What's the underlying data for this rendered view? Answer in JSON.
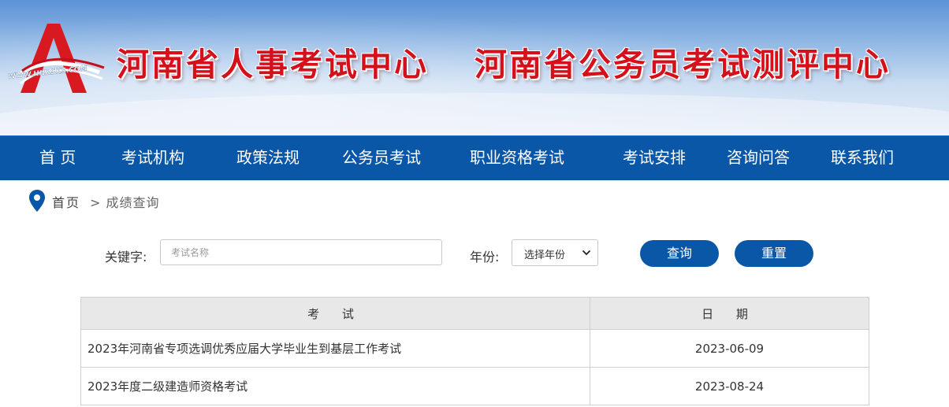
{
  "header": {
    "logo_text": "WWW.HNRSKS.COM",
    "title_left": "河南省人事考试中心",
    "title_right": "河南省公务员考试测评中心"
  },
  "nav": {
    "items": [
      {
        "label": "首 页"
      },
      {
        "label": "考试机构"
      },
      {
        "label": "政策法规"
      },
      {
        "label": "公务员考试"
      },
      {
        "label": "职业资格考试"
      },
      {
        "label": "考试安排"
      },
      {
        "label": "咨询问答"
      },
      {
        "label": "联系我们"
      }
    ]
  },
  "breadcrumb": {
    "home": "首页",
    "current": "> 成绩查询"
  },
  "search": {
    "keyword_label": "关键字:",
    "keyword_placeholder": "考试名称",
    "keyword_value": "",
    "year_label": "年份:",
    "year_selected": "选择年份",
    "query_button": "查询",
    "reset_button": "重置"
  },
  "table": {
    "columns": [
      "考 试",
      "日 期"
    ],
    "rows": [
      {
        "exam": "2023年河南省专项选调优秀应届大学毕业生到基层工作考试",
        "date": "2023-06-09"
      },
      {
        "exam": "2023年度二级建造师资格考试",
        "date": "2023-08-24"
      }
    ]
  },
  "colors": {
    "nav_blue": "#0a57a8",
    "title_red": "#d4101b"
  },
  "icons": {
    "logo": "logo-icon",
    "location": "location-pin-icon",
    "dropdown": "chevron-down-icon"
  }
}
